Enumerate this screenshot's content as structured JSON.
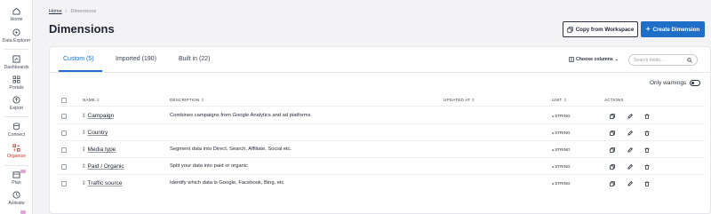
{
  "sidebar": {
    "items": [
      {
        "label": "Home",
        "icon": "home-icon"
      },
      {
        "label": "Data Explorer",
        "icon": "compass-icon"
      },
      {
        "label": "Dashboards",
        "icon": "dashboard-icon"
      },
      {
        "label": "Portals",
        "icon": "grid-icon"
      },
      {
        "label": "Export",
        "icon": "export-icon"
      },
      {
        "label": "Connect",
        "icon": "database-icon"
      },
      {
        "label": "Organize",
        "icon": "organize-icon"
      },
      {
        "label": "Plan",
        "icon": "calendar-icon"
      },
      {
        "label": "Activate",
        "icon": "activate-icon"
      }
    ]
  },
  "breadcrumb": {
    "home": "Home",
    "current": "Dimensions"
  },
  "page": {
    "title": "Dimensions"
  },
  "buttons": {
    "copy": "Copy from Workspace",
    "create": "Create Dimension"
  },
  "tabs": [
    {
      "label": "Custom (5)"
    },
    {
      "label": "Imported (190)"
    },
    {
      "label": "Built in (22)"
    }
  ],
  "toolbar": {
    "choose_columns": "Choose columns",
    "search_placeholder": "Search fields..."
  },
  "only_warnings": "Only warnings",
  "table": {
    "headers": {
      "name": "NAME",
      "description": "DESCRIPTION",
      "updated": "UPDATED AT",
      "unit": "UNIT",
      "actions": "ACTIONS"
    },
    "rows": [
      {
        "name": "Campaign",
        "description": "Combines campaigns from Google Analytics and ad platforms",
        "unit": "STRING"
      },
      {
        "name": "Country",
        "description": "",
        "unit": "STRING"
      },
      {
        "name": "Media type",
        "description": "Segment data into Direct, Search, Affiliate, Social etc.",
        "unit": "STRING"
      },
      {
        "name": "Paid / Organic",
        "description": "Split your data into paid or organic",
        "unit": "STRING"
      },
      {
        "name": "Traffic source",
        "description": "Identify which data is Google, Facebook, Bing, etc",
        "unit": "STRING"
      }
    ]
  },
  "colors": {
    "accent": "#1f6fc9",
    "active_nav": "#c0392b"
  }
}
